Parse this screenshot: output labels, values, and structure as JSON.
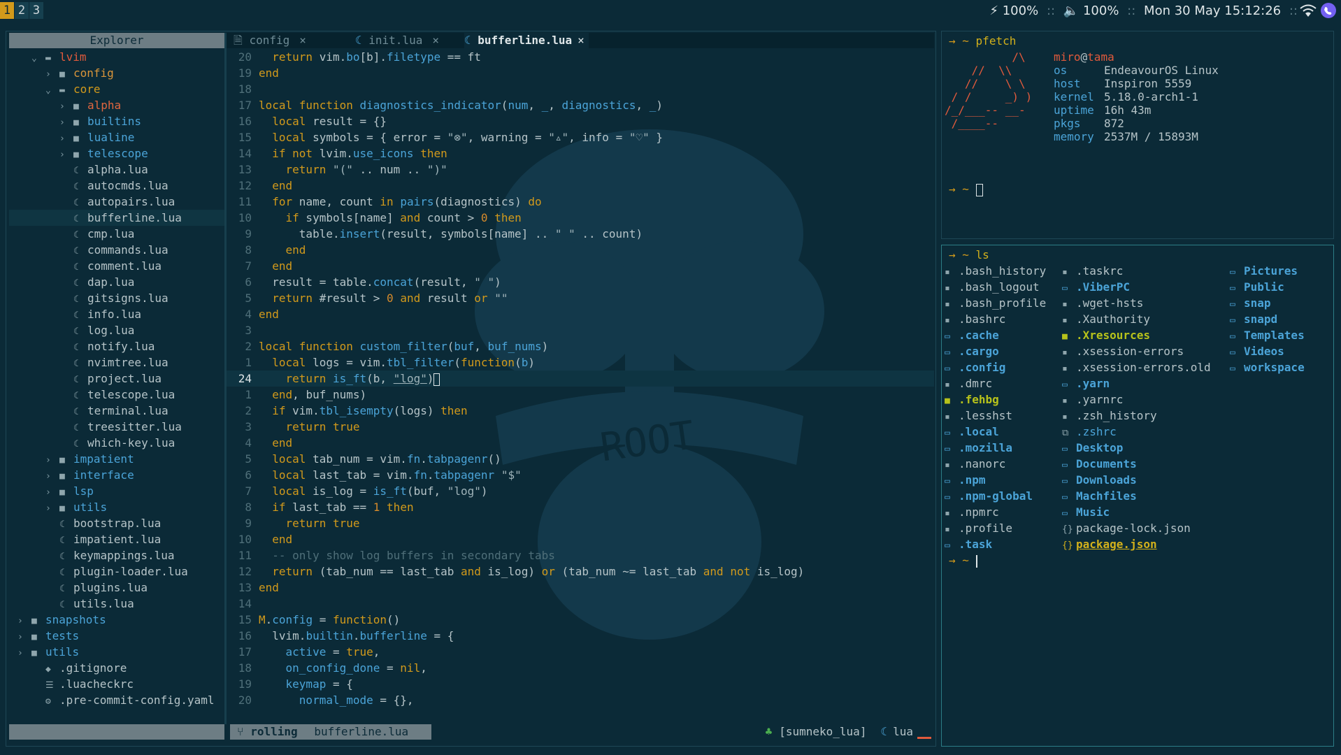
{
  "topbar": {
    "workspaces": [
      "1",
      "2",
      "3"
    ],
    "active_workspace": "1",
    "battery": "100%",
    "volume": "100%",
    "datetime": "Mon 30 May 15:12:26",
    "sep": "::",
    "tray_icons": [
      "wifi-icon",
      "viber-icon"
    ]
  },
  "editor": {
    "explorer_title": "Explorer",
    "tabs": [
      {
        "label": "config",
        "icon": "file-icon",
        "close": "×"
      },
      {
        "label": "init.lua",
        "icon": "lua-icon",
        "close": "×"
      },
      {
        "label": "bufferline.lua",
        "icon": "lua-icon",
        "close": "×",
        "active": true
      }
    ],
    "tree": [
      {
        "label": "lvim",
        "type": "dir-open",
        "depth": 1
      },
      {
        "label": "config",
        "type": "dir",
        "depth": 2
      },
      {
        "label": "core",
        "type": "dir-open",
        "depth": 2
      },
      {
        "label": "alpha",
        "type": "dir",
        "depth": 3
      },
      {
        "label": "builtins",
        "type": "dir",
        "depth": 3
      },
      {
        "label": "lualine",
        "type": "dir",
        "depth": 3
      },
      {
        "label": "telescope",
        "type": "dir",
        "depth": 3
      },
      {
        "label": "alpha.lua",
        "type": "file",
        "depth": 3
      },
      {
        "label": "autocmds.lua",
        "type": "file",
        "depth": 3
      },
      {
        "label": "autopairs.lua",
        "type": "file",
        "depth": 3
      },
      {
        "label": "bufferline.lua",
        "type": "file",
        "depth": 3,
        "selected": true
      },
      {
        "label": "cmp.lua",
        "type": "file",
        "depth": 3
      },
      {
        "label": "commands.lua",
        "type": "file",
        "depth": 3
      },
      {
        "label": "comment.lua",
        "type": "file",
        "depth": 3
      },
      {
        "label": "dap.lua",
        "type": "file",
        "depth": 3
      },
      {
        "label": "gitsigns.lua",
        "type": "file",
        "depth": 3
      },
      {
        "label": "info.lua",
        "type": "file",
        "depth": 3
      },
      {
        "label": "log.lua",
        "type": "file",
        "depth": 3
      },
      {
        "label": "notify.lua",
        "type": "file",
        "depth": 3
      },
      {
        "label": "nvimtree.lua",
        "type": "file",
        "depth": 3
      },
      {
        "label": "project.lua",
        "type": "file",
        "depth": 3
      },
      {
        "label": "telescope.lua",
        "type": "file",
        "depth": 3
      },
      {
        "label": "terminal.lua",
        "type": "file",
        "depth": 3
      },
      {
        "label": "treesitter.lua",
        "type": "file",
        "depth": 3
      },
      {
        "label": "which-key.lua",
        "type": "file",
        "depth": 3
      },
      {
        "label": "impatient",
        "type": "dir",
        "depth": 2
      },
      {
        "label": "interface",
        "type": "dir",
        "depth": 2
      },
      {
        "label": "lsp",
        "type": "dir",
        "depth": 2
      },
      {
        "label": "utils",
        "type": "dir",
        "depth": 2
      },
      {
        "label": "bootstrap.lua",
        "type": "file",
        "depth": 2
      },
      {
        "label": "impatient.lua",
        "type": "file",
        "depth": 2
      },
      {
        "label": "keymappings.lua",
        "type": "file",
        "depth": 2
      },
      {
        "label": "plugin-loader.lua",
        "type": "file",
        "depth": 2
      },
      {
        "label": "plugins.lua",
        "type": "file",
        "depth": 2
      },
      {
        "label": "utils.lua",
        "type": "file",
        "depth": 2
      },
      {
        "label": "snapshots",
        "type": "dir",
        "depth": 0
      },
      {
        "label": "tests",
        "type": "dir",
        "depth": 0
      },
      {
        "label": "utils",
        "type": "dir",
        "depth": 0
      },
      {
        "label": ".gitignore",
        "type": "dotfile-git",
        "depth": 1
      },
      {
        "label": ".luacheckrc",
        "type": "dotfile-list",
        "depth": 1
      },
      {
        "label": ".pre-commit-config.yaml",
        "type": "dotfile-gear",
        "depth": 1
      }
    ],
    "code_lines": [
      {
        "n": "20",
        "html": "  <span class='kw'>return</span> vim.<span class='prop'>bo</span>[b].<span class='prop'>filetype</span> == ft"
      },
      {
        "n": "19",
        "html": "<span class='kw'>end</span>"
      },
      {
        "n": "18",
        "html": ""
      },
      {
        "n": "17",
        "html": "<span class='kw'>local function</span> <span class='fn'>diagnostics_indicator</span>(<span class='prop'>num</span>, <span class='prop'>_</span>, <span class='prop'>diagnostics</span>, <span class='prop'>_</span>)"
      },
      {
        "n": "16",
        "html": "  <span class='kw'>local</span> result = {}"
      },
      {
        "n": "15",
        "html": "  <span class='kw'>local</span> symbols = { error = <span class='str'>\"⊗\"</span>, warning = <span class='str'>\"▵\"</span>, info = <span class='str'>\"♡\"</span> }"
      },
      {
        "n": "14",
        "html": "  <span class='kw'>if not</span> lvim.<span class='prop'>use_icons</span> <span class='kw'>then</span>"
      },
      {
        "n": "13",
        "html": "    <span class='kw'>return</span> <span class='str'>\"(\"</span> .. num .. <span class='str'>\")\"</span>"
      },
      {
        "n": "12",
        "html": "  <span class='kw'>end</span>"
      },
      {
        "n": "11",
        "html": "  <span class='kw'>for</span> name, count <span class='kw'>in</span> <span class='fn'>pairs</span>(diagnostics) <span class='kw'>do</span>"
      },
      {
        "n": "10",
        "html": "    <span class='kw'>if</span> symbols[name] <span class='kw'>and</span> count > <span class='num'>0</span> <span class='kw'>then</span>"
      },
      {
        "n": "9",
        "html": "      table.<span class='fn'>insert</span>(result, symbols[name] .. <span class='str'>\" \"</span> .. count)"
      },
      {
        "n": "8",
        "html": "    <span class='kw'>end</span>"
      },
      {
        "n": "7",
        "html": "  <span class='kw'>end</span>"
      },
      {
        "n": "6",
        "html": "  result = table.<span class='fn'>concat</span>(result, <span class='str'>\" \"</span>)"
      },
      {
        "n": "5",
        "html": "  <span class='kw'>return</span> #result > <span class='num'>0</span> <span class='kw'>and</span> result <span class='kw'>or</span> <span class='str'>\"\"</span>"
      },
      {
        "n": "4",
        "html": "<span class='kw'>end</span>"
      },
      {
        "n": "3",
        "html": ""
      },
      {
        "n": "2",
        "html": "<span class='kw'>local function</span> <span class='fn'>custom_filter</span>(<span class='prop'>buf</span>, <span class='prop'>buf_nums</span>)"
      },
      {
        "n": "1",
        "html": "  <span class='kw'>local</span> logs = vim.<span class='fn'>tbl_filter</span>(<span class='kw'>function</span>(<span class='prop'>b</span>)"
      },
      {
        "n": "24",
        "html": "    <span class='kw'>return</span> <span class='fn'>is_ft</span>(b, <span class='str' style='text-decoration:underline'>\"log\"</span>)",
        "current": true
      },
      {
        "n": "1",
        "html": "  <span class='kw'>end</span>, buf_nums)"
      },
      {
        "n": "2",
        "html": "  <span class='kw'>if</span> vim.<span class='fn'>tbl_isempty</span>(logs) <span class='kw'>then</span>"
      },
      {
        "n": "3",
        "html": "    <span class='kw'>return true</span>"
      },
      {
        "n": "4",
        "html": "  <span class='kw'>end</span>"
      },
      {
        "n": "5",
        "html": "  <span class='kw'>local</span> tab_num = vim.<span class='prop'>fn</span>.<span class='fn'>tabpagenr</span>()"
      },
      {
        "n": "6",
        "html": "  <span class='kw'>local</span> last_tab = vim.<span class='prop'>fn</span>.<span class='fn'>tabpagenr</span> <span class='str'>\"$\"</span>"
      },
      {
        "n": "7",
        "html": "  <span class='kw'>local</span> is_log = <span class='fn'>is_ft</span>(buf, <span class='str'>\"log\"</span>)"
      },
      {
        "n": "8",
        "html": "  <span class='kw'>if</span> last_tab == <span class='num'>1</span> <span class='kw'>then</span>"
      },
      {
        "n": "9",
        "html": "    <span class='kw'>return true</span>"
      },
      {
        "n": "10",
        "html": "  <span class='kw'>end</span>"
      },
      {
        "n": "11",
        "html": "  <span class='cmt'>-- only show log buffers in secondary tabs</span>"
      },
      {
        "n": "12",
        "html": "  <span class='kw'>return</span> (tab_num == last_tab <span class='kw'>and</span> is_log) <span class='kw'>or</span> (tab_num ~= last_tab <span class='kw'>and not</span> is_log)"
      },
      {
        "n": "13",
        "html": "<span class='kw'>end</span>"
      },
      {
        "n": "14",
        "html": ""
      },
      {
        "n": "15",
        "html": "<span class='tbl'>M</span>.<span class='prop'>config</span> = <span class='kw'>function</span>()"
      },
      {
        "n": "16",
        "html": "  lvim.<span class='prop'>builtin</span>.<span class='prop'>bufferline</span> = {"
      },
      {
        "n": "17",
        "html": "    <span class='prop'>active</span> = <span class='kw'>true</span>,"
      },
      {
        "n": "18",
        "html": "    <span class='prop'>on_config_done</span> = <span class='kw'>nil</span>,"
      },
      {
        "n": "19",
        "html": "    <span class='prop'>keymap</span> = {"
      },
      {
        "n": "20",
        "html": "      <span class='prop'>normal_mode</span> = {},"
      }
    ],
    "statusline": {
      "branch": "rolling",
      "filename": "bufferline.lua",
      "lsp": "[sumneko_lua]",
      "filetype": "lua"
    }
  },
  "terminal1": {
    "prompt": "→ ~",
    "command": "pfetch",
    "user": "miro",
    "at": "@",
    "host": "tama",
    "ascii": [
      "          /\\",
      "    //  \\\\",
      "   //    \\ \\",
      " / /     _) )",
      "/_/___-- __-",
      " /____--"
    ],
    "fields": [
      {
        "k": "os",
        "v": "EndeavourOS Linux"
      },
      {
        "k": "host",
        "v": "Inspiron 5559"
      },
      {
        "k": "kernel",
        "v": "5.18.0-arch1-1"
      },
      {
        "k": "uptime",
        "v": "16h 43m"
      },
      {
        "k": "pkgs",
        "v": "872"
      },
      {
        "k": "memory",
        "v": "2537M / 15893M"
      }
    ]
  },
  "terminal2": {
    "prompt": "→ ~",
    "command": "ls",
    "columns": [
      [
        {
          "name": ".bash_history",
          "kind": "file"
        },
        {
          "name": ".bash_logout",
          "kind": "file"
        },
        {
          "name": ".bash_profile",
          "kind": "file"
        },
        {
          "name": ".bashrc",
          "kind": "file"
        },
        {
          "name": ".cache",
          "kind": "dir"
        },
        {
          "name": ".cargo",
          "kind": "dir"
        },
        {
          "name": ".config",
          "kind": "dir"
        },
        {
          "name": ".dmrc",
          "kind": "file"
        },
        {
          "name": ".fehbg",
          "kind": "exec"
        },
        {
          "name": ".lesshst",
          "kind": "file"
        },
        {
          "name": ".local",
          "kind": "dir"
        },
        {
          "name": ".mozilla",
          "kind": "dir"
        },
        {
          "name": ".nanorc",
          "kind": "file"
        },
        {
          "name": ".npm",
          "kind": "dir"
        },
        {
          "name": ".npm-global",
          "kind": "dir"
        },
        {
          "name": ".npmrc",
          "kind": "file"
        },
        {
          "name": ".profile",
          "kind": "file"
        },
        {
          "name": ".task",
          "kind": "dir"
        }
      ],
      [
        {
          "name": ".taskrc",
          "kind": "file"
        },
        {
          "name": ".ViberPC",
          "kind": "dir"
        },
        {
          "name": ".wget-hsts",
          "kind": "file"
        },
        {
          "name": ".Xauthority",
          "kind": "file"
        },
        {
          "name": ".Xresources",
          "kind": "exec"
        },
        {
          "name": ".xsession-errors",
          "kind": "file"
        },
        {
          "name": ".xsession-errors.old",
          "kind": "file"
        },
        {
          "name": ".yarn",
          "kind": "dir"
        },
        {
          "name": ".yarnrc",
          "kind": "file"
        },
        {
          "name": ".zsh_history",
          "kind": "file"
        },
        {
          "name": ".zshrc",
          "kind": "link"
        },
        {
          "name": "Desktop",
          "kind": "dir"
        },
        {
          "name": "Documents",
          "kind": "dir"
        },
        {
          "name": "Downloads",
          "kind": "dir"
        },
        {
          "name": "Machfiles",
          "kind": "dir"
        },
        {
          "name": "Music",
          "kind": "dir"
        },
        {
          "name": "package-lock.json",
          "kind": "file-json"
        },
        {
          "name": "package.json",
          "kind": "json"
        }
      ],
      [
        {
          "name": "Pictures",
          "kind": "dir"
        },
        {
          "name": "Public",
          "kind": "dir"
        },
        {
          "name": "snap",
          "kind": "dir"
        },
        {
          "name": "snapd",
          "kind": "dir"
        },
        {
          "name": "Templates",
          "kind": "dir"
        },
        {
          "name": "Videos",
          "kind": "dir"
        },
        {
          "name": "workspace",
          "kind": "dir"
        }
      ]
    ]
  },
  "colors": {
    "background": "#0b2a37",
    "accent": "#d29a1b",
    "blue": "#4ba4d8",
    "red": "#e05a3c"
  },
  "watermark_text": "ROOT"
}
